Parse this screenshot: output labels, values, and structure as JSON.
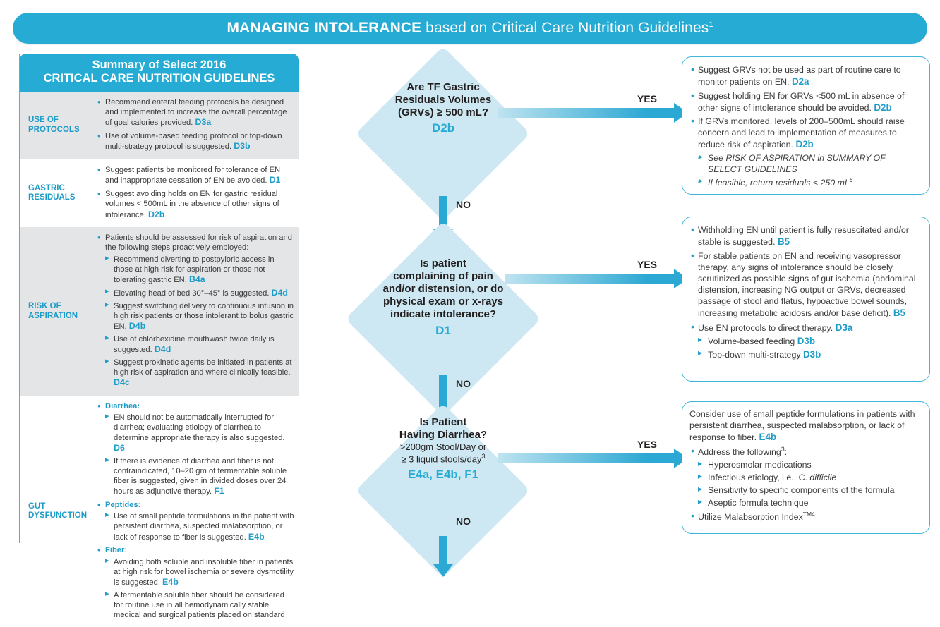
{
  "banner": {
    "title_strong": "MANAGING INTOLERANCE",
    "title_rest": " based on Critical Care Nutrition Guidelines",
    "superscript": "1"
  },
  "summary": {
    "header_line1": "Summary of Select 2016",
    "header_line2": "CRITICAL CARE NUTRITION GUIDELINES",
    "rows": [
      {
        "category": "USE OF PROTOCOLS",
        "bullets": [
          {
            "text": "Recommend enteral feeding protocols be designed and implemented to increase the overall percentage of goal calories provided.",
            "code": "D3a"
          },
          {
            "text": "Use of volume-based feeding protocol or top-down multi-strategy protocol is suggested.",
            "code": "D3b"
          }
        ]
      },
      {
        "category": "GASTRIC RESIDUALS",
        "bullets": [
          {
            "text": "Suggest patients be monitored for tolerance of EN and inappropriate cessation of EN be avoided.",
            "code": "D1"
          },
          {
            "text": "Suggest avoiding holds on EN for gastric residual volumes < 500mL in the absence of other signs of intolerance.",
            "code": "D2b"
          }
        ]
      },
      {
        "category": "RISK OF ASPIRATION",
        "bullets": [
          {
            "text": "Patients should be assessed for risk of aspiration and the following steps proactively employed:",
            "code": "",
            "sub": [
              {
                "text": "Recommend diverting to postpyloric access in those at high risk for aspiration or those not tolerating gastric EN.",
                "code": "B4a"
              },
              {
                "text": "Elevating head of bed 30°–45° is suggested.",
                "code": "D4d"
              },
              {
                "text": "Suggest switching delivery to continuous infusion in high risk patients or those intolerant to bolus gastric EN.",
                "code": "D4b"
              },
              {
                "text": "Use of chlorhexidine mouthwash twice daily is suggested.",
                "code": "D4d"
              },
              {
                "text": "Suggest prokinetic agents be initiated in patients at high risk of aspiration and where clinically feasible.",
                "code": "D4c"
              }
            ]
          }
        ]
      },
      {
        "category": "GUT DYSFUNCTION",
        "bullets": [
          {
            "label": "Diarrhea:",
            "text": "",
            "code": "",
            "sub": [
              {
                "text": "EN should not be automatically interrupted for diarrhea; evaluating etiology of diarrhea to determine appropriate therapy is also suggested.",
                "code": "D6"
              },
              {
                "text": "If there is evidence of diarrhea and fiber is not contraindicated, 10–20 gm of fermentable soluble fiber is suggested, given in divided doses over 24 hours as adjunctive therapy.",
                "code": "F1"
              }
            ]
          },
          {
            "label": "Peptides:",
            "text": "",
            "code": "",
            "sub": [
              {
                "text": "Use of small peptide formulations in the patient with persistent diarrhea, suspected malabsorption, or lack of response to fiber is suggested.",
                "code": "E4b"
              }
            ]
          },
          {
            "label": "Fiber:",
            "text": "",
            "code": "",
            "sub": [
              {
                "text": "Avoiding both soluble and insoluble fiber in patients at high risk for bowel ischemia or severe dysmotility is suggested.",
                "code": "E4b"
              },
              {
                "text": "A fermentable soluble fiber should be considered for routine use in all hemodynamically stable medical and surgical patients placed on standard",
                "code": ""
              }
            ]
          }
        ]
      }
    ]
  },
  "flow": {
    "nodes": [
      {
        "id": "grv",
        "question_lines": [
          "Are TF Gastric",
          "Residuals Volumes",
          "(GRVs) ≥ 500 mL?"
        ],
        "sub_lines": [],
        "code": "D2b",
        "yes_label": "YES",
        "no_label": "NO"
      },
      {
        "id": "pain",
        "question_lines": [
          "Is patient",
          "complaining of pain",
          "and/or distension, or do",
          "physical exam or x-rays",
          "indicate intolerance?"
        ],
        "sub_lines": [],
        "code": "D1",
        "yes_label": "YES",
        "no_label": "NO"
      },
      {
        "id": "diarrhea",
        "question_lines": [
          "Is Patient",
          "Having Diarrhea?"
        ],
        "sub_lines": [
          ">200gm Stool/Day or",
          "≥ 3 liquid stools/day"
        ],
        "sub_sup": "3",
        "code": "E4a, E4b, F1",
        "yes_label": "YES",
        "no_label": "NO"
      }
    ]
  },
  "outcomes": [
    {
      "id": "grv-outcome",
      "bullets": [
        {
          "text": "Suggest GRVs not be used as part of routine care to monitor patients on EN.",
          "code": "D2a"
        },
        {
          "text": "Suggest holding EN for GRVs <500 mL in absence of other signs of intolerance should be avoided.",
          "code": "D2b"
        },
        {
          "text": "If GRVs monitored, levels of 200–500mL should raise concern and lead to implementation of measures to reduce risk of aspiration.",
          "code": "D2b",
          "sub": [
            {
              "text": "See RISK OF ASPIRATION in SUMMARY OF SELECT GUIDELINES",
              "italic": true
            },
            {
              "text": "If feasible, return residuals < 250 mL",
              "sup": "6",
              "italic": true
            }
          ]
        }
      ]
    },
    {
      "id": "pain-outcome",
      "bullets": [
        {
          "text": "Withholding EN until patient is fully resuscitated and/or stable is suggested.",
          "code": "B5"
        },
        {
          "text": "For stable patients on EN and receiving vasopressor therapy, any signs of intolerance should be closely scrutinized as possible signs of gut ischemia (abdominal distension, increasing NG output or GRVs, decreased passage of stool and flatus, hypoactive bowel sounds, increasing metabolic acidosis and/or base deficit).",
          "code": "B5"
        },
        {
          "text": "Use EN protocols to direct therapy.",
          "code": "D3a",
          "sub": [
            {
              "text": "Volume-based feeding",
              "code": "D3b"
            },
            {
              "text": "Top-down multi-strategy",
              "code": "D3b"
            }
          ]
        }
      ]
    },
    {
      "id": "diarrhea-outcome",
      "lead": "Consider use of small peptide formulations in patients with persistent diarrhea, suspected malabsorption, or lack of response to fiber.",
      "lead_code": "E4b",
      "bullets": [
        {
          "text": "Address the following",
          "sup": "3",
          "text_after": ":",
          "sub": [
            {
              "text": "Hyperosmolar medications"
            },
            {
              "text": "Infectious etiology, i.e., C. difficile",
              "italic_part": "difficile"
            },
            {
              "text": "Sensitivity to specific components of the formula"
            },
            {
              "text": "Aseptic formula technique"
            }
          ]
        },
        {
          "text": "Utilize Malabsorption Index",
          "tm": "TM4"
        }
      ]
    }
  ],
  "colors": {
    "brand_cyan": "#26ACD4",
    "diamond_fill": "#CDE8F2",
    "row_alt": "#E4E5E6",
    "text_dark": "#3b3b3b"
  }
}
